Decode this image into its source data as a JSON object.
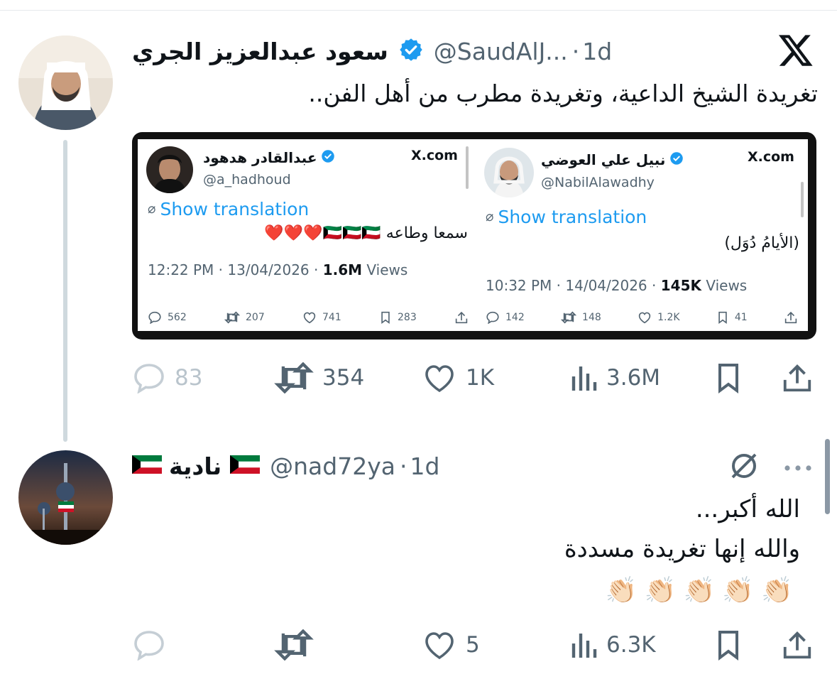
{
  "post": {
    "author_name": "سعود عبدالعزيز الجري",
    "handle": "@SaudAlJ...",
    "time_sep": "·",
    "time": "1d",
    "text": "تغريدة الشيخ الداعية، وتغريدة مطرب من أهل الفن..",
    "actions": {
      "replies": "83",
      "reposts": "354",
      "likes": "1K",
      "views": "3.6M"
    },
    "embedded": [
      {
        "name": "عبدالقادر هدهود",
        "handle": "@a_hadhoud",
        "site": "X.com",
        "translate": "Show translation",
        "text": "سمعا وطاعه 🇰🇼🇰🇼🇰🇼❤️❤️❤️",
        "time": "12:22 PM · 13/04/2026 · ",
        "views_count": "1.6M",
        "views_label": " Views",
        "replies": "562",
        "reposts": "207",
        "likes": "741",
        "bookmarks": "283"
      },
      {
        "name": "نبيل علي العوضي",
        "handle": "@NabilAlawadhy",
        "site": "X.com",
        "translate": "Show translation",
        "text": "(الأيامُ دُوَل)",
        "time": "10:32 PM · 14/04/2026 · ",
        "views_count": "145K",
        "views_label": " Views",
        "replies": "142",
        "reposts": "148",
        "likes": "1.2K",
        "bookmarks": "41"
      }
    ]
  },
  "reply": {
    "author_name": "نادية",
    "handle": "@nad72ya",
    "time_sep": "·",
    "time": "1d",
    "text_line1": "الله أكبر...",
    "text_line2": "والله إنها تغريدة مسددة",
    "text_line3": "👏🏻👏🏻👏🏻👏🏻👏🏻",
    "actions": {
      "replies": "",
      "reposts": "",
      "likes": "5",
      "views": "6.3K"
    }
  },
  "colors": {
    "verified": "#1d9bf0",
    "muted_text": "#536471",
    "link": "#1d9bf0",
    "thread_line": "#cfd9de"
  }
}
